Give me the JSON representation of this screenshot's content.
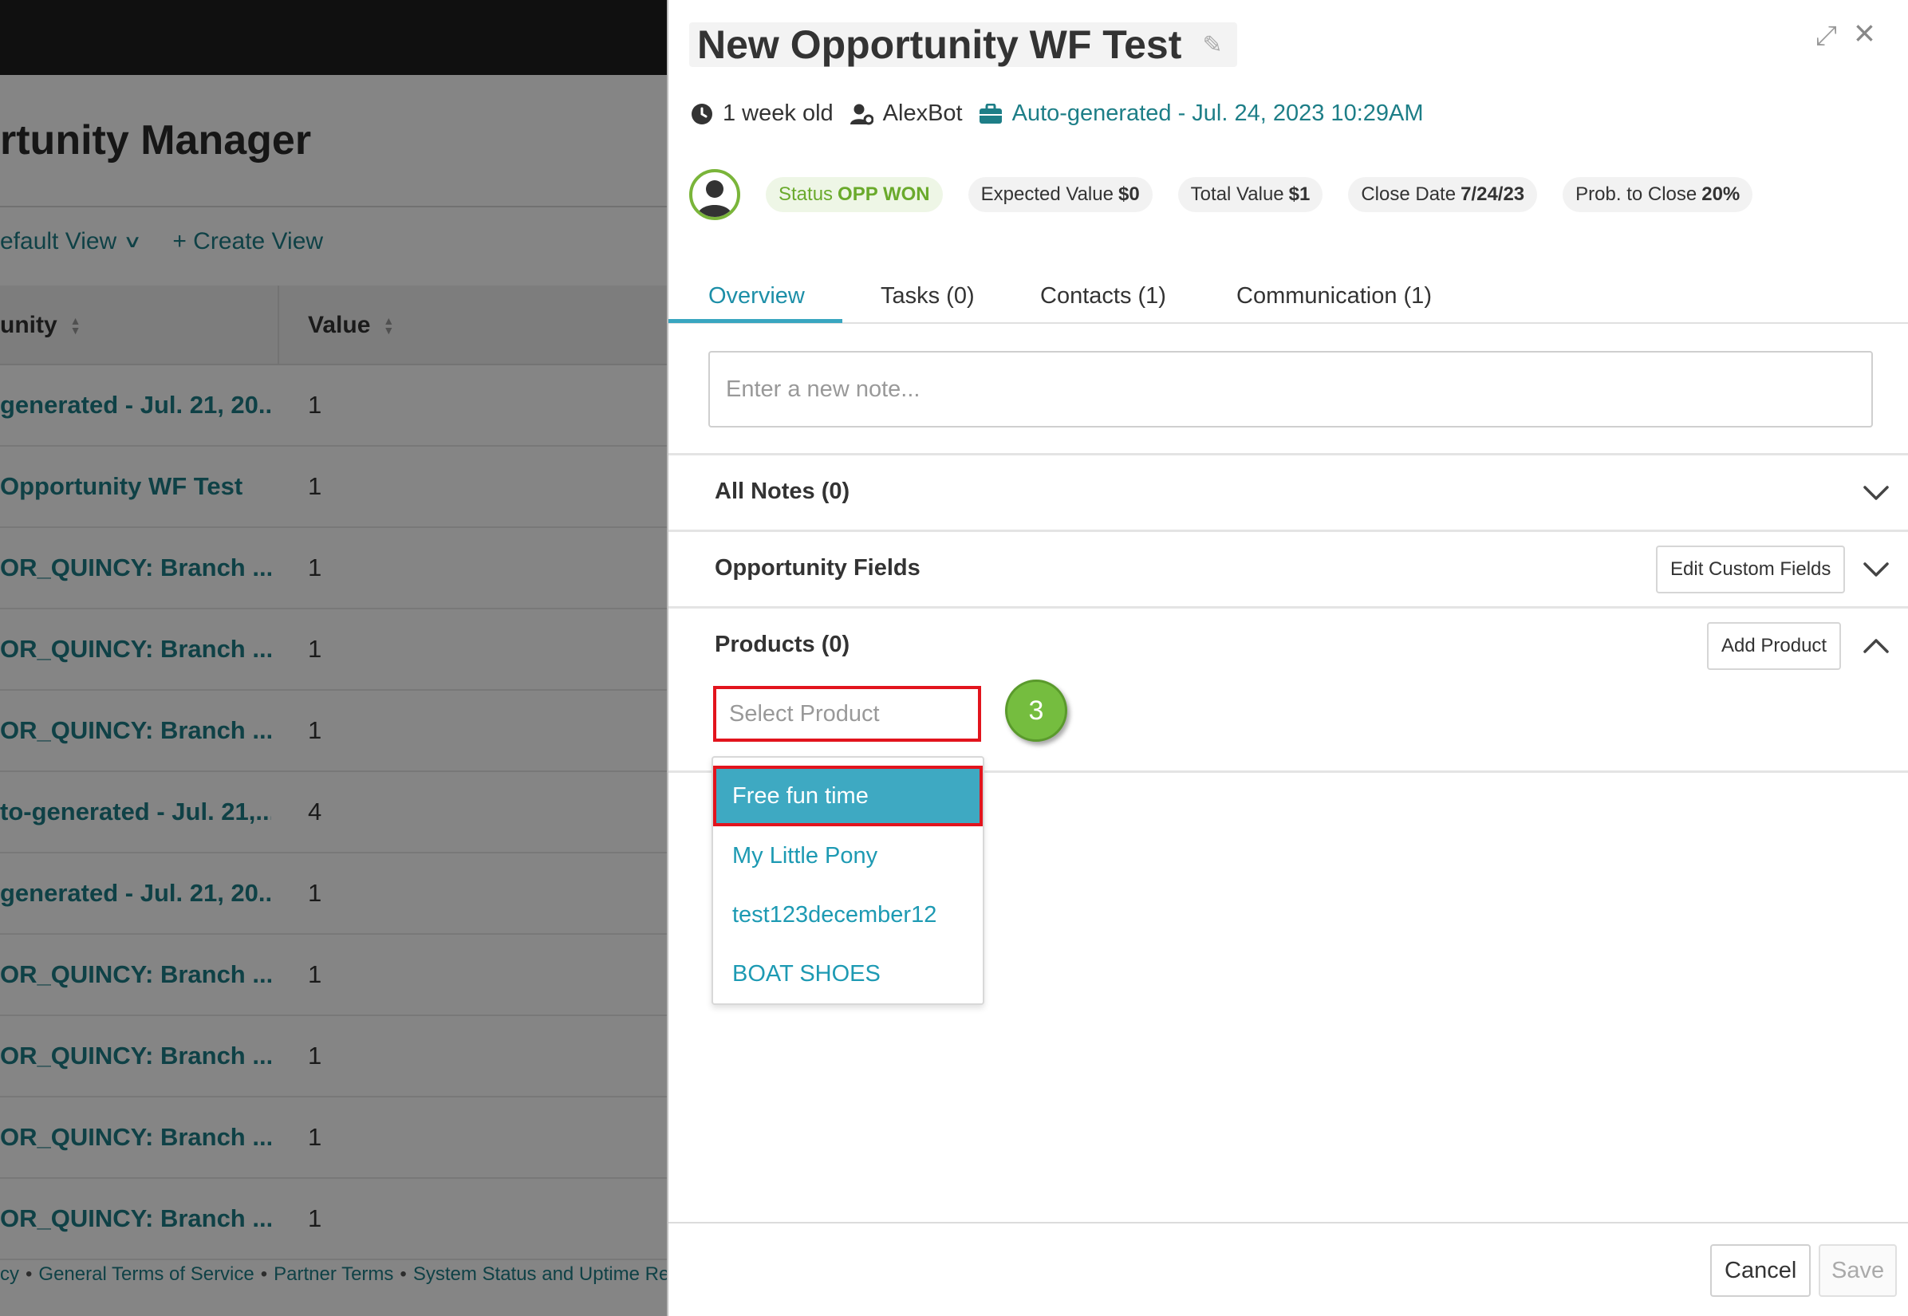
{
  "background": {
    "page_title": "rtunity Manager",
    "view_selector": "efault View",
    "create_view": "+ Create View",
    "columns": [
      "unity",
      "Value"
    ],
    "rows": [
      {
        "name": "generated - Jul. 21, 20...",
        "value": "1"
      },
      {
        "name": "Opportunity WF Test",
        "value": "1"
      },
      {
        "name": "OR_QUINCY: Branch ...",
        "value": "1"
      },
      {
        "name": "OR_QUINCY: Branch ...",
        "value": "1"
      },
      {
        "name": "OR_QUINCY: Branch ...",
        "value": "1"
      },
      {
        "name": "to-generated - Jul. 21,...",
        "value": "4"
      },
      {
        "name": "generated - Jul. 21, 20...",
        "value": "1"
      },
      {
        "name": "OR_QUINCY: Branch ...",
        "value": "1"
      },
      {
        "name": "OR_QUINCY: Branch ...",
        "value": "1"
      },
      {
        "name": "OR_QUINCY: Branch ...",
        "value": "1"
      },
      {
        "name": "OR_QUINCY: Branch ...",
        "value": "1"
      }
    ],
    "footer_links": [
      "cy",
      "General Terms of Service",
      "Partner Terms",
      "System Status and Uptime Repo"
    ]
  },
  "panel": {
    "title": "New Opportunity WF Test",
    "meta": {
      "age": "1 week old",
      "owner": "AlexBot",
      "source": "Auto-generated - Jul. 24, 2023 10:29AM"
    },
    "badges": [
      {
        "label": "Status",
        "value": "OPP WON"
      },
      {
        "label": "Expected Value",
        "value": "$0"
      },
      {
        "label": "Total Value",
        "value": "$1"
      },
      {
        "label": "Close Date",
        "value": "7/24/23"
      },
      {
        "label": "Prob. to Close",
        "value": "20%"
      }
    ],
    "tabs": [
      "Overview",
      "Tasks (0)",
      "Contacts (1)",
      "Communication (1)"
    ],
    "note_placeholder": "Enter a new note...",
    "sections": {
      "all_notes": "All Notes (0)",
      "opportunity_fields": "Opportunity Fields",
      "edit_custom_fields": "Edit Custom Fields",
      "products": "Products (0)",
      "add_product": "Add Product"
    },
    "select_product_placeholder": "Select Product",
    "step_number": "3",
    "product_options": [
      "Free fun time",
      "My Little Pony",
      "test123december12",
      "BOAT SHOES"
    ],
    "cancel_label": "Cancel",
    "save_label": "Save"
  },
  "colors": {
    "accent": "#38a6c0",
    "link": "#1d7e87",
    "status_green": "#6aaa2c",
    "highlight_red": "#e2141d",
    "step_badge_green": "#75bd3f"
  }
}
